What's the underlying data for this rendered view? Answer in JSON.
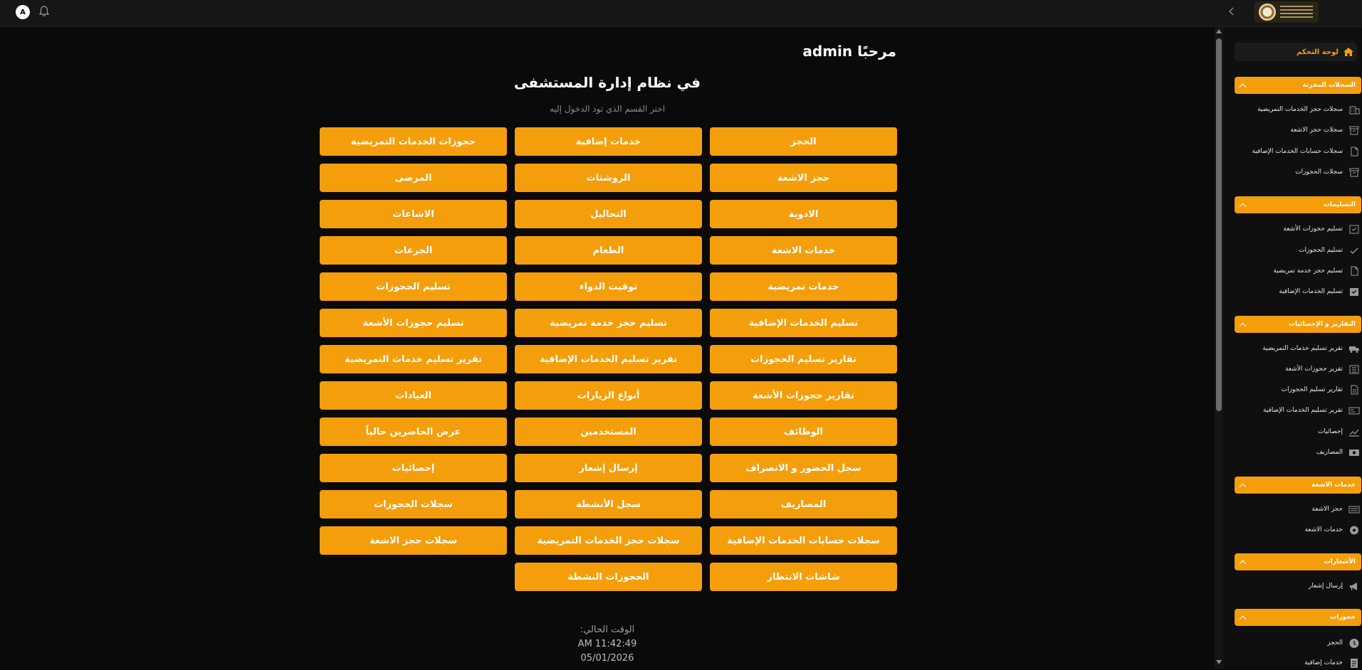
{
  "topbar": {
    "avatar_letter": "A"
  },
  "main": {
    "welcome": "مرحبًا admin",
    "subtitle": "في نظام إدارة المستشفى",
    "hint": "اختر القسم الذي تود الدخول إليه",
    "buttons": [
      "الحجز",
      "خدمات إضافية",
      "حجوزات الخدمات التمريضية",
      "حجز الاشعة",
      "الروشتات",
      "المرضى",
      "الادوية",
      "التحاليل",
      "الاشاعات",
      "خدمات الاشعة",
      "الطعام",
      "الجرعات",
      "خدمات تمريضية",
      "توقيت الدواء",
      "تسليم الحجوزات",
      "تسليم الخدمات الإضافية",
      "تسليم حجز خدمة تمريضية",
      "تسليم حجوزات الأشعة",
      "تقارير تسليم الحجوزات",
      "تقرير تسليم الخدمات الإضافية",
      "تقرير تسليم خدمات التمريضية",
      "تقارير حجوزات الأشعة",
      "أنواع الزيارات",
      "العيادات",
      "الوظائف",
      "المستخدمين",
      "عرض الحاضرين حالياً",
      "سجل الحضور و الانصراف",
      "إرسال إشعار",
      "إحصائيات",
      "المصاريف",
      "سجل الأنشطة",
      "سجلات الحجوزات",
      "سجلات حسابات الخدمات الإضافية",
      "سجلات حجز الخدمات التمريضية",
      "سجلات حجز الاشعة",
      "شاشات الانتظار",
      "الحجوزات النشطة"
    ],
    "clock": {
      "label": "الوقت الحالي:",
      "time": "AM 11:42:49",
      "date": "05/01/2026"
    }
  },
  "sidebar": {
    "dashboard": "لوحة التحكم",
    "sections": [
      {
        "title": "السجلات المخزنة",
        "items": [
          {
            "label": "سجلات حجز الخدمات التمريضية",
            "icon": "building-icon"
          },
          {
            "label": "سجلات حجز الاشعة",
            "icon": "archive-icon"
          },
          {
            "label": "سجلات حسابات الخدمات الإضافية",
            "icon": "file-icon"
          },
          {
            "label": "سجلات الحجوزات",
            "icon": "archive-icon"
          }
        ]
      },
      {
        "title": "التسليمات",
        "items": [
          {
            "label": "تسليم حجوزات الأشعة",
            "icon": "tray-check-icon"
          },
          {
            "label": "تسليم الحجوزات",
            "icon": "check-icon"
          },
          {
            "label": "تسليم حجز خدمة تمريضية",
            "icon": "file-icon"
          },
          {
            "label": "تسليم الخدمات الإضافية",
            "icon": "checkbox-icon"
          }
        ]
      },
      {
        "title": "التقارير و الإحصائيات",
        "items": [
          {
            "label": "تقرير تسليم خدمات التمريضية",
            "icon": "truck-icon"
          },
          {
            "label": "تقرير حجوزات الأشعة",
            "icon": "list-icon"
          },
          {
            "label": "تقارير تسليم الحجوزات",
            "icon": "report-icon"
          },
          {
            "label": "تقرير تسليم الخدمات الإضافية",
            "icon": "card-icon"
          },
          {
            "label": "إحصائيات",
            "icon": "chart-icon"
          },
          {
            "label": "المصاريف",
            "icon": "money-icon"
          }
        ]
      },
      {
        "title": "خدمات الاشعة",
        "items": [
          {
            "label": "حجز الاشعة",
            "icon": "scan-icon"
          },
          {
            "label": "خدمات الاشعة",
            "icon": "disc-icon"
          }
        ]
      },
      {
        "title": "الأشعارات",
        "items": [
          {
            "label": "إرسال إشعار",
            "icon": "megaphone-icon"
          }
        ]
      },
      {
        "title": "حجوزات",
        "items": [
          {
            "label": "الحجز",
            "icon": "clock-icon"
          },
          {
            "label": "خدمات إضافية",
            "icon": "doc-icon"
          }
        ]
      }
    ]
  }
}
